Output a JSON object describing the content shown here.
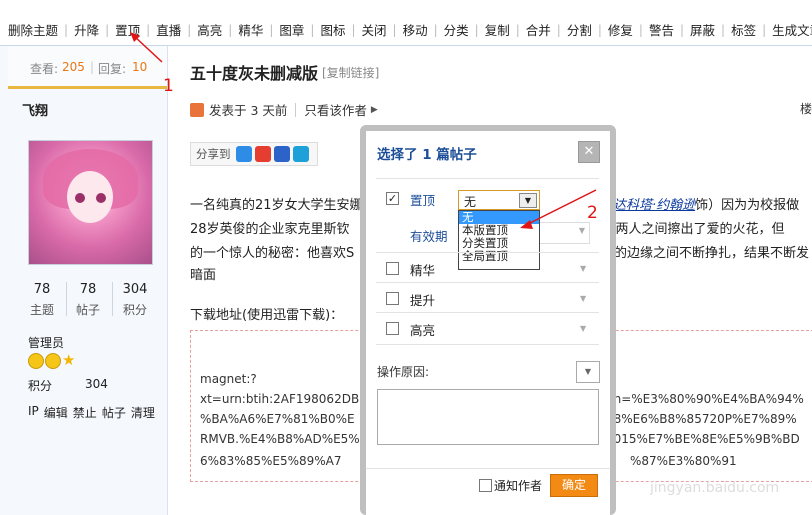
{
  "toolbar": {
    "items": [
      "删除主题",
      "升降",
      "置顶",
      "直播",
      "高亮",
      "精华",
      "图章",
      "图标",
      "关闭",
      "移动",
      "分类",
      "复制",
      "合并",
      "分割",
      "修复",
      "警告",
      "屏蔽",
      "标签",
      "生成文章"
    ]
  },
  "stats": {
    "views_label": "查看:",
    "views": "205",
    "replies_label": "回复:",
    "replies": "10"
  },
  "author": {
    "name": "飞翔",
    "counts": [
      {
        "value": "78",
        "label": "主题"
      },
      {
        "value": "78",
        "label": "帖子"
      },
      {
        "value": "304",
        "label": "积分"
      }
    ],
    "role": "管理员",
    "points_label": "积分",
    "points_value": "304",
    "admin_links": [
      "IP",
      "编辑",
      "禁止",
      "帖子",
      "清理"
    ]
  },
  "thread": {
    "title": "五十度灰未删减版",
    "copy_link": "[复制链接]",
    "posted": "发表于 3 天前",
    "only_author": "只看该作者",
    "floor": "楼"
  },
  "share": {
    "label": "分享到"
  },
  "body": {
    "line1_a": "一名纯真的21岁女大学生安娜",
    "line1_link": "达科塔·约翰逊",
    "line1_paren_open": "（",
    "line1_paren_close": "饰）因为为校报做",
    "line2_a": "28岁英俊的企业家克里斯钦",
    "line2_b": "），两人之间擦出了爱的火花，但",
    "line3_a": "的一个惊人的秘密：他喜欢S",
    "line3_b": "的边缘之间不断挣扎，结果不断发",
    "line4": "暗面",
    "download_label": "下载地址(使用迅雷下载)：",
    "magnet_1": "magnet:?",
    "magnet_2a": "xt=urn:btih:2AF198062DB",
    "magnet_2b": "dn=%E3%80%90%E4%BA%94%",
    "magnet_3a": "%BA%A6%E7%81%B0%E",
    "magnet_3b": "98%E6%B8%85720P%E7%89%",
    "magnet_4a": "RMVB.%E4%B8%AD%E5%",
    "magnet_4b": "2015%E7%BE%8E%E5%9B%BD",
    "magnet_5a": "6%83%85%E5%89%A7",
    "magnet_5b": "%87%E3%80%91"
  },
  "dialog": {
    "title": "选择了 1 篇帖子",
    "close": "✕",
    "pin_label": "置顶",
    "pin_value": "无",
    "pin_options": [
      "无",
      "本版置顶",
      "分类置顶",
      "全局置顶"
    ],
    "validity_label": "有效期",
    "digest_label": "精华",
    "bump_label": "提升",
    "highlight_label": "高亮",
    "reason_label": "操作原因:",
    "notify_label": "通知作者",
    "confirm": "确定"
  },
  "annotations": {
    "marker1": "1",
    "marker2": "2"
  },
  "watermark": "jingyan.baidu.com",
  "colors": {
    "accent": "#f28a13",
    "link": "#1c4e98",
    "annotation": "#e01414"
  }
}
